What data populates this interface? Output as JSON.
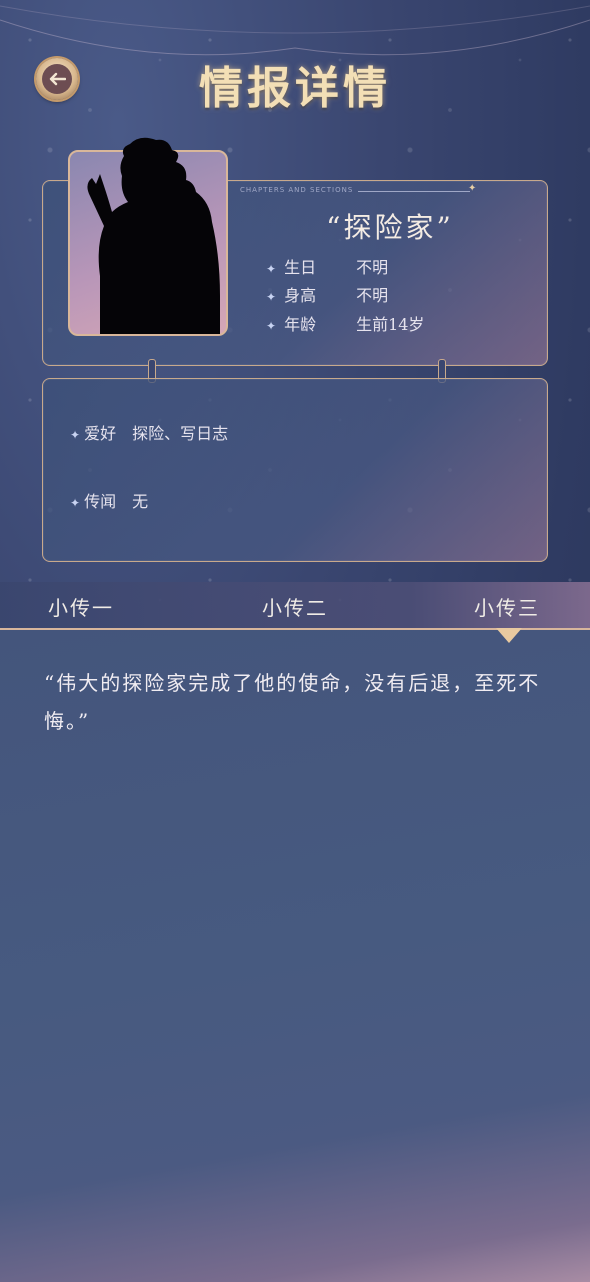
{
  "header": {
    "title": "情报详情",
    "back_icon": "arrow-left-icon"
  },
  "profile": {
    "chapter_tag": "CHAPTERS AND SECTIONS",
    "name": "“探险家”",
    "stats": [
      {
        "label": "生日",
        "value": "不明"
      },
      {
        "label": "身高",
        "value": "不明"
      },
      {
        "label": "年龄",
        "value": "生前14岁"
      }
    ]
  },
  "details": [
    {
      "label": "爱好",
      "value": "探险、写日志"
    },
    {
      "label": "传闻",
      "value": "无"
    }
  ],
  "tabs": [
    {
      "label": "小传一",
      "active": false
    },
    {
      "label": "小传二",
      "active": false
    },
    {
      "label": "小传三",
      "active": true
    }
  ],
  "story": {
    "text": "“伟大的探险家完成了他的使命，没有后退，至死不悔。”"
  },
  "colors": {
    "accent_gold": "#e8c9a0",
    "panel_blue": "#44557c",
    "title_gold": "#f3dfb6"
  }
}
